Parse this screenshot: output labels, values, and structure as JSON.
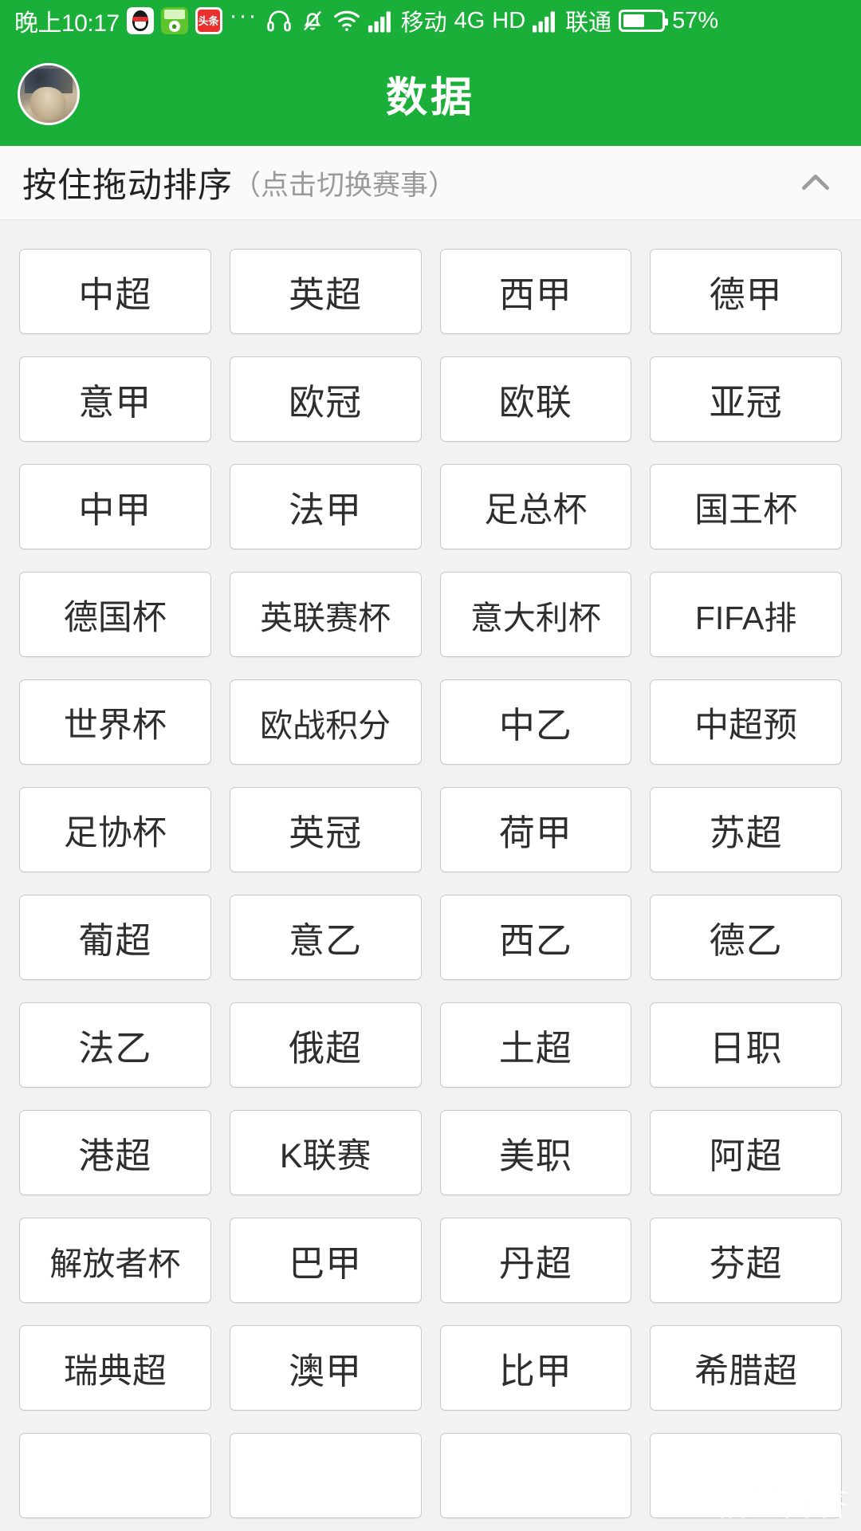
{
  "status_bar": {
    "clock": "晚上10:17",
    "app_icons": [
      {
        "name": "qq-icon",
        "label": "QQ"
      },
      {
        "name": "football-app-icon",
        "label": "球"
      },
      {
        "name": "toutiao-icon",
        "label": "头条"
      }
    ],
    "overflow": "···",
    "icons": [
      "headset-icon",
      "bell-muted-icon",
      "wifi-icon",
      "signal-icon"
    ],
    "carrier_1": "移动",
    "network_type": "4G",
    "hd_label": "HD",
    "carrier_2": "联通",
    "battery_percent": "57%",
    "battery_level": 57
  },
  "title_bar": {
    "title": "数据",
    "avatar_name": "user-avatar"
  },
  "section_header": {
    "title_main": "按住拖动排序",
    "title_sub": "（点击切换赛事）",
    "collapse_icon": "chevron-up-icon"
  },
  "leagues": [
    "中超",
    "英超",
    "西甲",
    "德甲",
    "意甲",
    "欧冠",
    "欧联",
    "亚冠",
    "中甲",
    "法甲",
    "足总杯",
    "国王杯",
    "德国杯",
    "英联赛杯",
    "意大利杯",
    "FIFA排",
    "世界杯",
    "欧战积分",
    "中乙",
    "中超预",
    "足协杯",
    "英冠",
    "荷甲",
    "苏超",
    "葡超",
    "意乙",
    "西乙",
    "德乙",
    "法乙",
    "俄超",
    "土超",
    "日职",
    "港超",
    "K联赛",
    "美职",
    "阿超",
    "解放者杯",
    "巴甲",
    "丹超",
    "芬超",
    "瑞典超",
    "澳甲",
    "比甲",
    "希腊超",
    "",
    "",
    "",
    ""
  ],
  "watermark": {
    "text": "悟空问答",
    "logo_name": "wukong-logo-icon"
  },
  "colors": {
    "brand_green": "#1aaf39",
    "page_background": "#f2f2f2",
    "button_background": "#ffffff",
    "button_border": "#c9c9c9",
    "primary_text": "#2e2e2e",
    "muted_text": "#9a9a9a"
  }
}
